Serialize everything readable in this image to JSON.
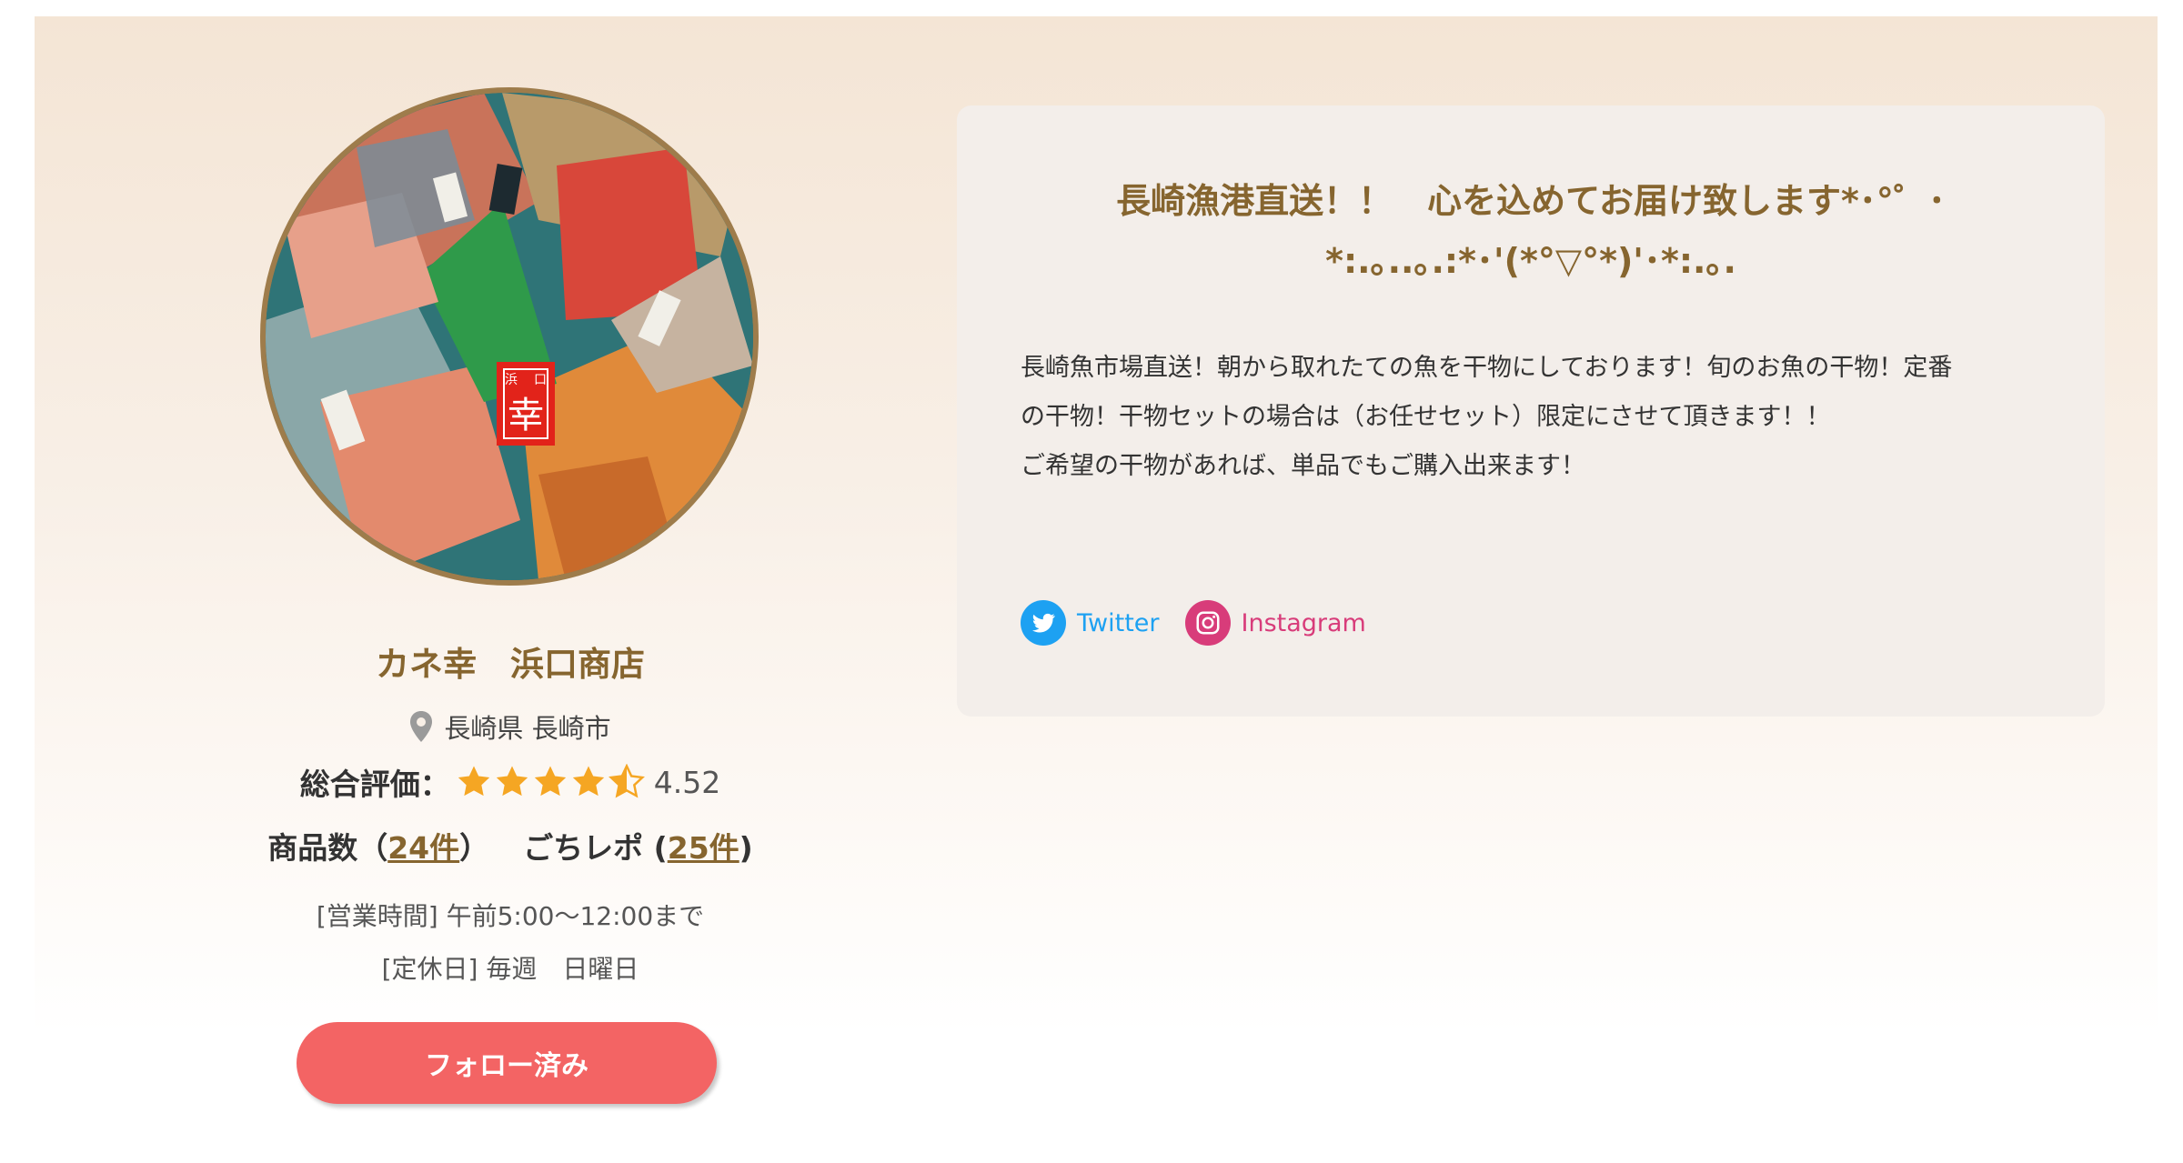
{
  "shop": {
    "name": "カネ幸　浜口商店",
    "location": "長崎県 長崎市",
    "rating_label": "総合評価：",
    "rating_value": "4.52",
    "rating_stars": 4.5,
    "products_label": "商品数（",
    "products_count": "24件",
    "products_close": "）",
    "reviews_label": "ごちレポ (",
    "reviews_count": "25件",
    "reviews_close": ")",
    "hours": "[営業時間] 午前5:00～12:00まで",
    "holiday": "[定休日] 毎週　日曜日",
    "follow_label": "フォロー済み",
    "badge_text": "幸",
    "badge_small_left": "浜",
    "badge_small_right": "口"
  },
  "profile": {
    "headline_line1": "長崎漁港直送！！　心を込めてお届け致します*･°゜･",
    "headline_line2": "*:.｡..｡.:*･'(*°▽°*)'･*:.｡.",
    "desc_line1": "長崎魚市場直送！朝から取れたての魚を干物にしております！旬のお魚の干物！定番",
    "desc_line2": "の干物！干物セットの場合は（お任せセット）限定にさせて頂きます！！",
    "desc_line3": "ご希望の干物があれば、単品でもご購入出来ます！"
  },
  "social": {
    "twitter": "Twitter",
    "instagram": "Instagram"
  },
  "colors": {
    "accent": "#86652f",
    "button": "#f36464",
    "star": "#f5a623",
    "twitter": "#1da1f2",
    "instagram": "#d83c7a"
  },
  "icons": {
    "location": "map-pin-icon",
    "star": "star-icon",
    "twitter": "twitter-bird-icon",
    "instagram": "instagram-camera-icon"
  }
}
